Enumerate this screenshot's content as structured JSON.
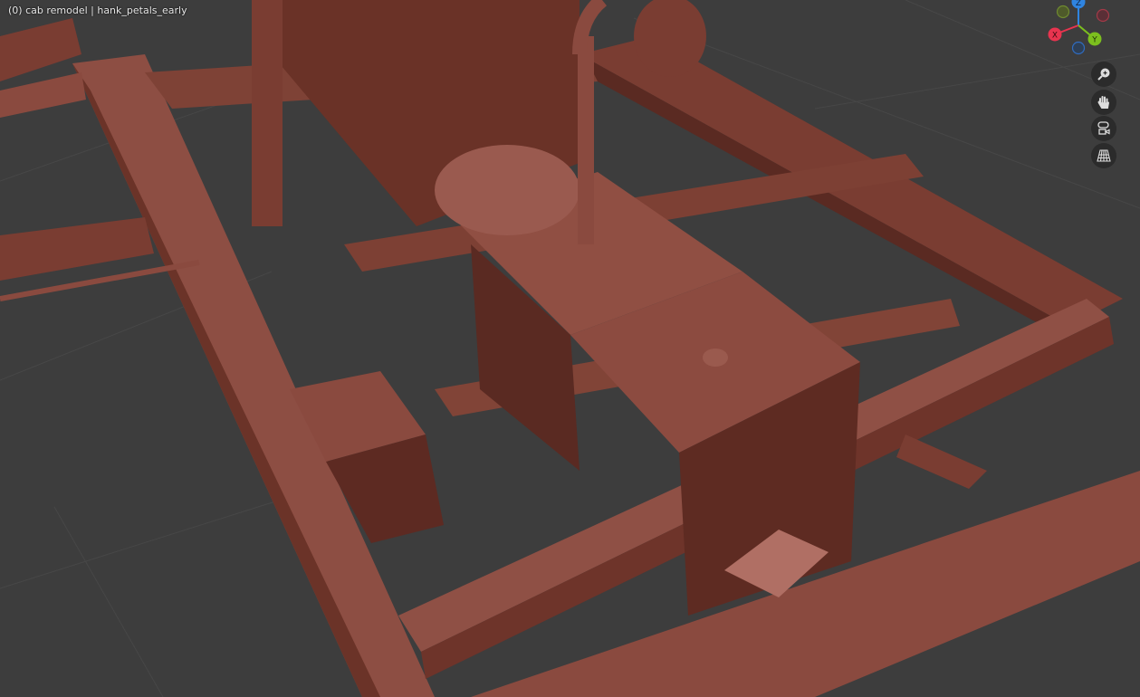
{
  "viewport": {
    "header_text": "(0) cab remodel | hank_petals_early",
    "axes": {
      "x": "X",
      "y": "Y",
      "z": "Z"
    },
    "colors": {
      "x": "#e8344f",
      "y": "#7cbf1e",
      "z": "#2f84e0",
      "model": "#8a4a3e",
      "background": "#3d3d3d"
    }
  },
  "nav_buttons": [
    "zoom-icon",
    "pan-hand-icon",
    "camera-view-icon",
    "perspective-grid-icon"
  ]
}
